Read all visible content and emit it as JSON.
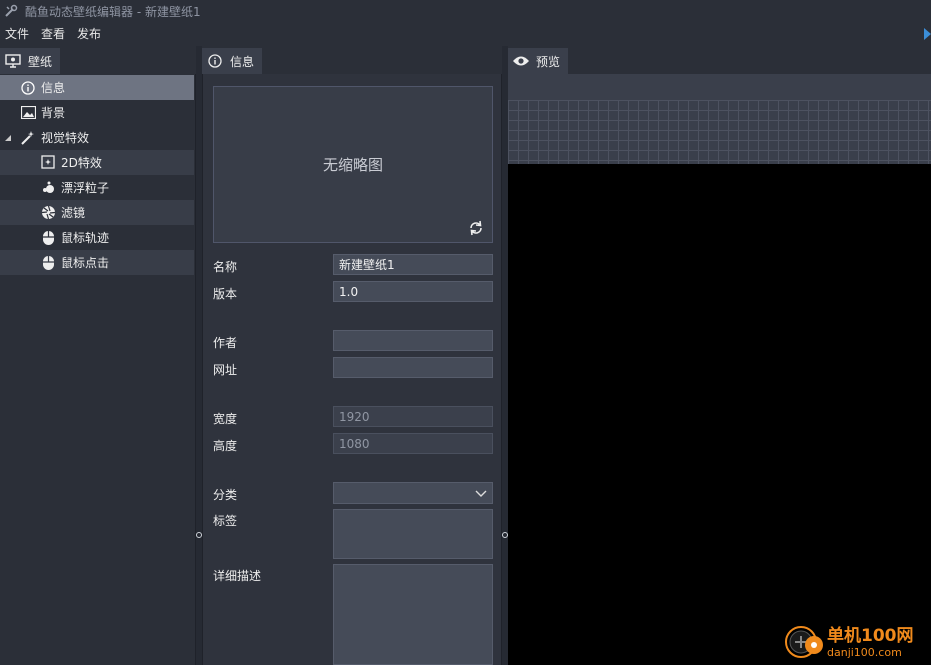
{
  "window": {
    "title": "酷鱼动态壁纸编辑器 - 新建壁纸1"
  },
  "menubar": {
    "items": [
      "文件",
      "查看",
      "发布"
    ]
  },
  "left_panel": {
    "tab_label": "壁纸",
    "tree": [
      {
        "label": "信息",
        "icon": "info-icon",
        "selected": true
      },
      {
        "label": "背景",
        "icon": "image-icon"
      },
      {
        "label": "视觉特效",
        "icon": "magic-wand-icon",
        "expanded": true
      },
      {
        "label": "2D特效",
        "icon": "sparkle-icon"
      },
      {
        "label": "漂浮粒子",
        "icon": "particles-icon"
      },
      {
        "label": "滤镜",
        "icon": "aperture-icon"
      },
      {
        "label": "鼠标轨迹",
        "icon": "mouse-icon"
      },
      {
        "label": "鼠标点击",
        "icon": "mouse-click-icon"
      }
    ]
  },
  "info_panel": {
    "tab_label": "信息",
    "thumbnail_text": "无缩略图",
    "fields": {
      "name": {
        "label": "名称",
        "value": "新建壁纸1"
      },
      "version": {
        "label": "版本",
        "value": "1.0"
      },
      "author": {
        "label": "作者",
        "value": ""
      },
      "url": {
        "label": "网址",
        "value": ""
      },
      "width": {
        "label": "宽度",
        "value": "1920"
      },
      "height": {
        "label": "高度",
        "value": "1080"
      },
      "category": {
        "label": "分类",
        "value": ""
      },
      "tags": {
        "label": "标签",
        "value": ""
      },
      "description": {
        "label": "详细描述",
        "value": ""
      }
    }
  },
  "preview_panel": {
    "tab_label": "预览"
  },
  "watermark": {
    "main": "单机100网",
    "sub": "danji100.com"
  },
  "colors": {
    "accent": "#3b8ed8",
    "watermark": "#f08a1c",
    "selected_row": "#6e7482"
  }
}
